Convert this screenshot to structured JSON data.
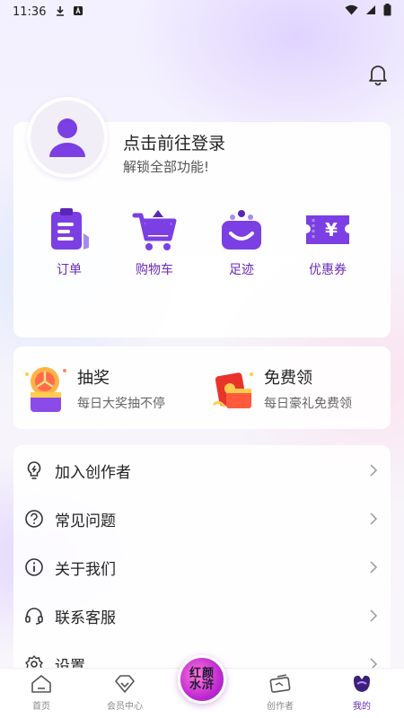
{
  "status_bar": {
    "time": "11:36"
  },
  "profile": {
    "login_title": "点击前往登录",
    "login_subtitle": "解锁全部功能!"
  },
  "quick_actions": [
    {
      "label": "订单",
      "icon": "order-icon"
    },
    {
      "label": "购物车",
      "icon": "cart-icon"
    },
    {
      "label": "足迹",
      "icon": "footprint-icon"
    },
    {
      "label": "优惠券",
      "icon": "coupon-icon"
    }
  ],
  "promos": [
    {
      "title": "抽奖",
      "subtitle": "每日大奖抽不停",
      "icon": "lottery-icon"
    },
    {
      "title": "免费领",
      "subtitle": "每日豪礼免费领",
      "icon": "gift-icon"
    }
  ],
  "menu": [
    {
      "label": "加入创作者",
      "icon": "bulb-icon"
    },
    {
      "label": "常见问题",
      "icon": "question-icon"
    },
    {
      "label": "关于我们",
      "icon": "info-icon"
    },
    {
      "label": "联系客服",
      "icon": "headset-icon"
    },
    {
      "label": "设置",
      "icon": "gear-icon"
    }
  ],
  "tabs": [
    {
      "label": "首页",
      "icon": "home-icon"
    },
    {
      "label": "会员中心",
      "icon": "diamond-icon"
    },
    {
      "label": "创作者",
      "icon": "creator-icon"
    },
    {
      "label": "我的",
      "icon": "profile-icon",
      "active": true
    }
  ],
  "center_logo": {
    "text": "红颜水浒"
  },
  "colors": {
    "accent": "#6a2ab8",
    "icon_purple": "#7b3fe4"
  }
}
